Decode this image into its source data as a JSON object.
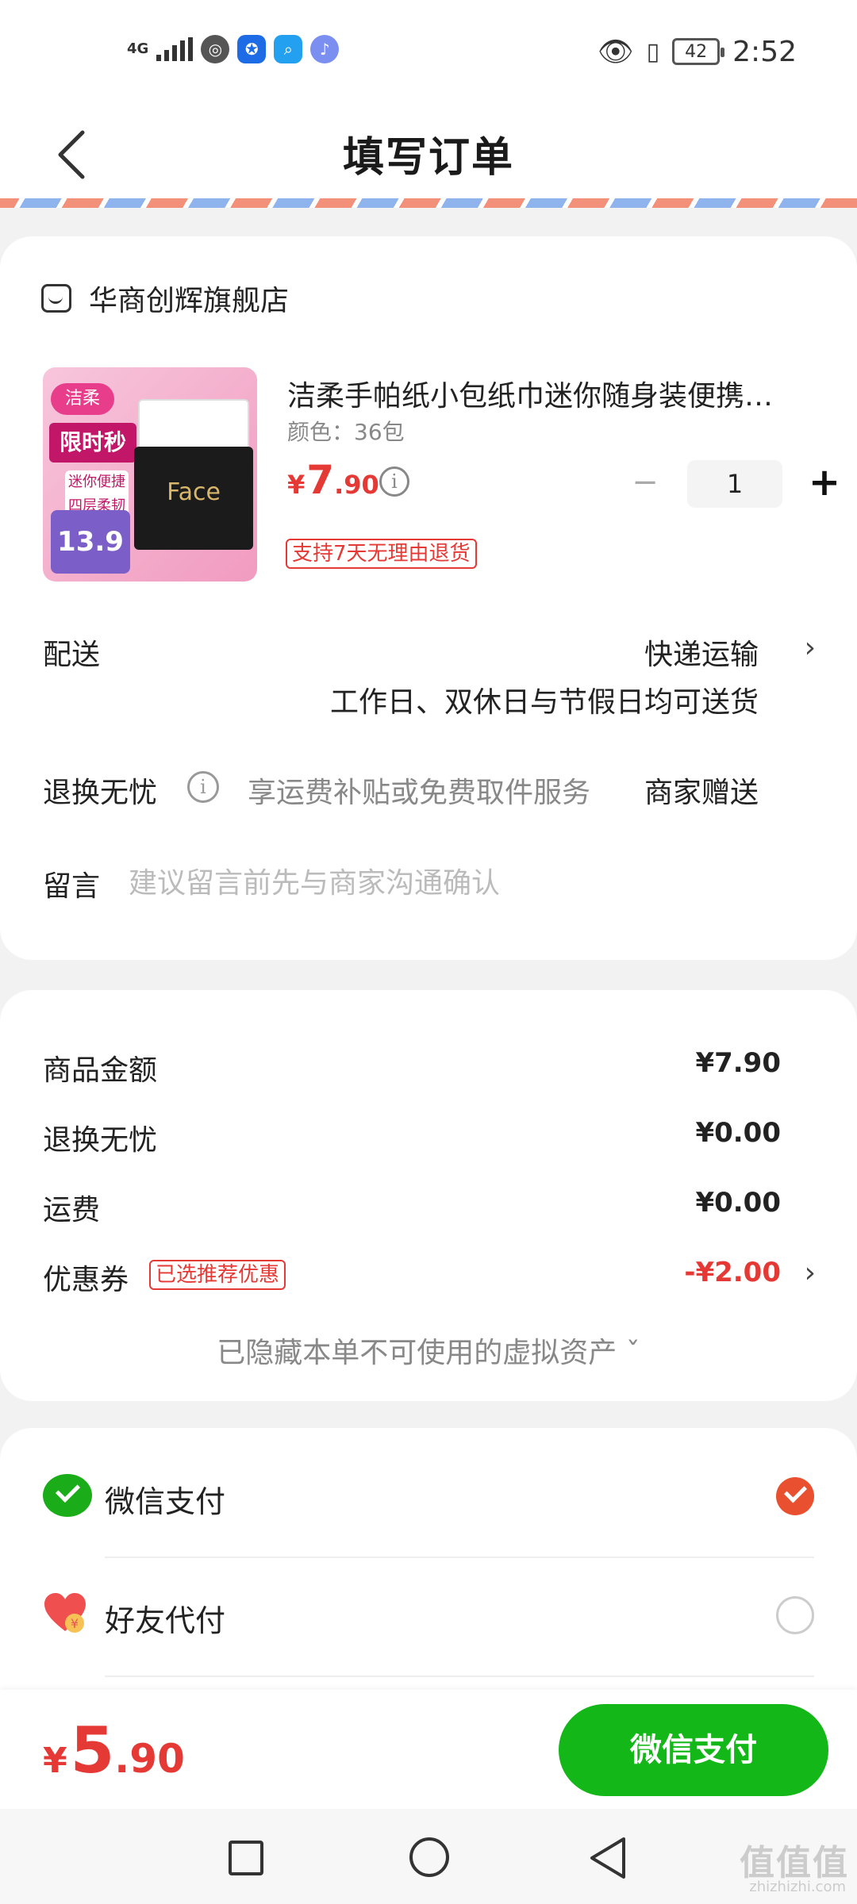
{
  "status_bar": {
    "network": "4G",
    "battery": "42",
    "time": "2:52"
  },
  "header": {
    "title": "填写订单"
  },
  "shop": {
    "name": "华商创辉旗舰店"
  },
  "product": {
    "name": "洁柔手帕纸小包纸巾迷你随身装便携…",
    "spec": "颜色：36包",
    "price_currency": "¥",
    "price_integer": "7",
    "price_decimal": ".90",
    "quantity": "1",
    "refund_tag": "支持7天无理由退货",
    "thumb_badge": "洁柔",
    "thumb_promo": "限时秒杀",
    "thumb_note": "迷你便捷 四层柔韧",
    "thumb_price": "13.9",
    "thumb_brand": "Face"
  },
  "delivery": {
    "label": "配送",
    "method": "快递运输",
    "note": "工作日、双休日与节假日均可送货"
  },
  "refund_worry": {
    "label": "退换无忧",
    "description": "享运费补贴或免费取件服务",
    "value": "商家赠送"
  },
  "message": {
    "label": "留言",
    "placeholder": "建议留言前先与商家沟通确认"
  },
  "summary": {
    "goods_label": "商品金额",
    "goods_value": "¥7.90",
    "refund_label": "退换无忧",
    "refund_value": "¥0.00",
    "shipping_label": "运费",
    "shipping_value": "¥0.00",
    "coupon_label": "优惠券",
    "coupon_tag": "已选推荐优惠",
    "coupon_value": "-¥2.00",
    "hidden_assets": "已隐藏本单不可使用的虚拟资产 ˇ"
  },
  "payment": {
    "options": [
      {
        "label": "微信支付",
        "selected": true
      },
      {
        "label": "好友代付",
        "selected": false
      }
    ]
  },
  "footer": {
    "total_currency": "¥",
    "total_integer": "5",
    "total_decimal": ".90",
    "pay_button": "微信支付"
  },
  "watermark": {
    "text": "值值值",
    "url": "zhizhizhi.com"
  },
  "colors": {
    "accent_red": "#e53935",
    "wechat_green": "#13b718"
  }
}
